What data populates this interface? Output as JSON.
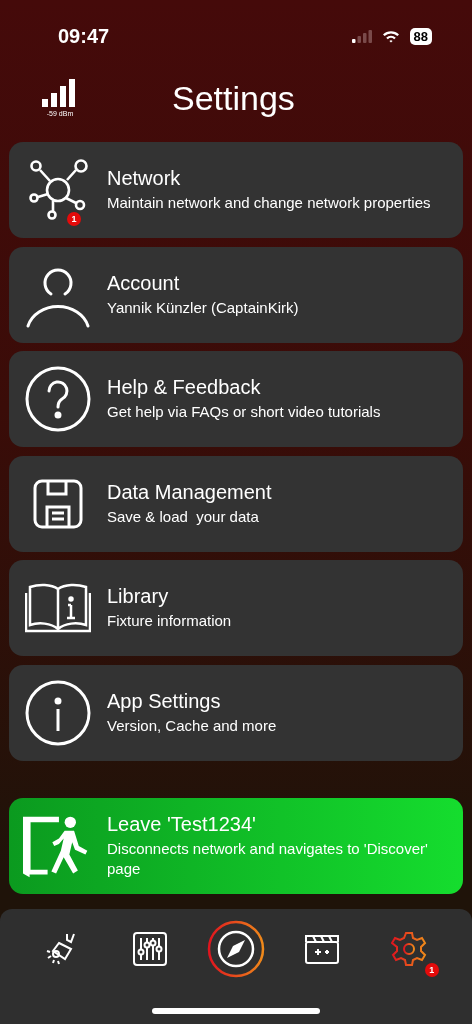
{
  "status_bar": {
    "time": "09:47",
    "battery": "88"
  },
  "header": {
    "signal_reading": "-59 dBm",
    "title": "Settings"
  },
  "items": [
    {
      "title": "Network",
      "subtitle": "Maintain network and change network properties",
      "badge": "1"
    },
    {
      "title": "Account",
      "subtitle": "Yannik Künzler (CaptainKirk)"
    },
    {
      "title": "Help & Feedback",
      "subtitle": "Get help via FAQs or short video tutorials"
    },
    {
      "title": "Data Management",
      "subtitle": "Save & load  your data"
    },
    {
      "title": "Library",
      "subtitle": "Fixture information"
    },
    {
      "title": "App Settings",
      "subtitle": "Version, Cache and more"
    }
  ],
  "leave_button": {
    "title": "Leave 'Test1234'",
    "subtitle": "Disconnects network and navigates to 'Discover' page"
  },
  "tab_bar": [
    {
      "selected": false
    },
    {
      "selected": false
    },
    {
      "selected": false
    },
    {
      "selected": false
    },
    {
      "selected": true,
      "badge": "1"
    }
  ]
}
